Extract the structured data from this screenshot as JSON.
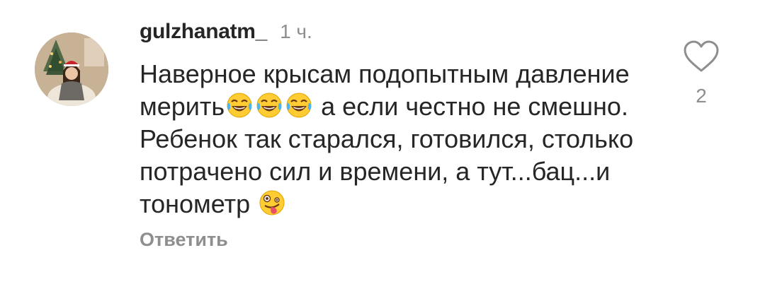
{
  "comment": {
    "username": "gulzhanatm_",
    "time": "1 ч.",
    "text_part1": "Наверное крысам подопытным давление мерить",
    "emoji_group1": [
      "face-with-tears-of-joy",
      "face-with-tears-of-joy",
      "face-with-tears-of-joy"
    ],
    "text_part2": " а если честно не смешно. Ребенок так старался, готовился, столько потрачено сил и времени, а тут...бац...и тонометр ",
    "emoji_group2": [
      "zany-face"
    ],
    "reply_label": "Ответить"
  },
  "like": {
    "icon": "heart-outline-icon",
    "count": "2"
  }
}
